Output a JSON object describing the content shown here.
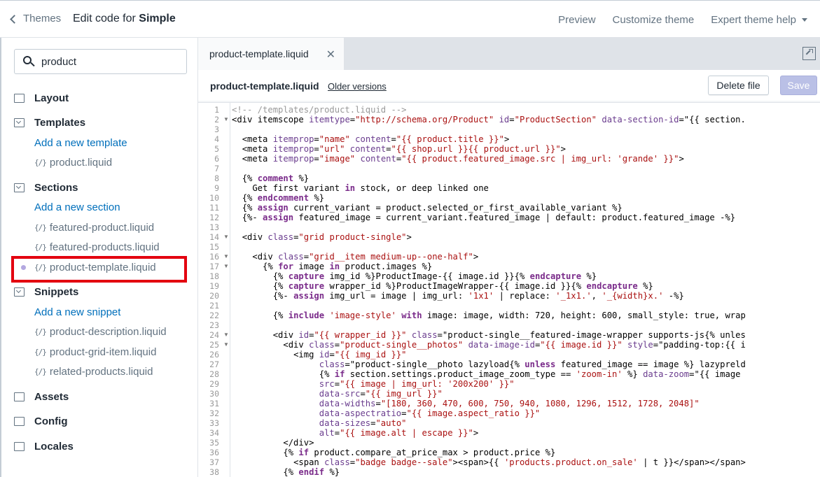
{
  "topbar": {
    "back_label": "Themes",
    "title_prefix": "Edit code for ",
    "title_theme": "Simple",
    "preview": "Preview",
    "customize": "Customize theme",
    "help": "Expert theme help"
  },
  "sidebar": {
    "search_value": "product",
    "layout_label": "Layout",
    "templates_label": "Templates",
    "add_template": "Add a new template",
    "template_files": [
      "product.liquid"
    ],
    "sections_label": "Sections",
    "add_section": "Add a new section",
    "section_files": [
      "featured-product.liquid",
      "featured-products.liquid",
      "product-template.liquid"
    ],
    "snippets_label": "Snippets",
    "add_snippet": "Add a new snippet",
    "snippet_files": [
      "product-description.liquid",
      "product-grid-item.liquid",
      "related-products.liquid"
    ],
    "assets_label": "Assets",
    "config_label": "Config",
    "locales_label": "Locales",
    "braces": "{/}"
  },
  "editor": {
    "tab_label": "product-template.liquid",
    "tab_close": "✕",
    "file_name": "product-template.liquid",
    "older_versions": "Older versions",
    "delete_label": "Delete file",
    "save_label": "Save"
  },
  "code_lines": [
    "<!-- /templates/product.liquid -->",
    "<div itemscope itemtype=\"http://schema.org/Product\" id=\"ProductSection\" data-section-id=\"{{ section.",
    "",
    "  <meta itemprop=\"name\" content=\"{{ product.title }}\">",
    "  <meta itemprop=\"url\" content=\"{{ shop.url }}{{ product.url }}\">",
    "  <meta itemprop=\"image\" content=\"{{ product.featured_image.src | img_url: 'grande' }}\">",
    "",
    "  {% comment %}",
    "    Get first variant in stock, or deep linked one",
    "  {% endcomment %}",
    "  {% assign current_variant = product.selected_or_first_available_variant %}",
    "  {%- assign featured_image = current_variant.featured_image | default: product.featured_image -%}",
    "",
    "  <div class=\"grid product-single\">",
    "",
    "    <div class=\"grid__item medium-up--one-half\">",
    "      {% for image in product.images %}",
    "        {% capture img_id %}ProductImage-{{ image.id }}{% endcapture %}",
    "        {% capture wrapper_id %}ProductImageWrapper-{{ image.id }}{% endcapture %}",
    "        {%- assign img_url = image | img_url: '1x1' | replace: '_1x1.', '_{width}x.' -%}",
    "",
    "        {% include 'image-style' with image: image, width: 720, height: 600, small_style: true, wrap",
    "",
    "        <div id=\"{{ wrapper_id }}\" class=\"product-single__featured-image-wrapper supports-js{% unles",
    "          <div class=\"product-single__photos\" data-image-id=\"{{ image.id }}\" style=\"padding-top:{{ i",
    "            <img id=\"{{ img_id }}\"",
    "                 class=\"product-single__photo lazyload{% unless featured_image == image %} lazypreld",
    "                 {% if section.settings.product_image_zoom_type == 'zoom-in' %} data-zoom=\"{{ image",
    "                 src=\"{{ image | img_url: '200x200' }}\"",
    "                 data-src=\"{{ img_url }}\"",
    "                 data-widths=\"[180, 360, 470, 600, 750, 940, 1080, 1296, 1512, 1728, 2048]\"",
    "                 data-aspectratio=\"{{ image.aspect_ratio }}\"",
    "                 data-sizes=\"auto\"",
    "                 alt=\"{{ image.alt | escape }}\">",
    "          </div>",
    "          {% if product.compare_at_price_max > product.price %}",
    "            <span class=\"badge badge--sale\"><span>{{ 'products.product.on_sale' | t }}</span></span>",
    "          {% endif %}"
  ]
}
